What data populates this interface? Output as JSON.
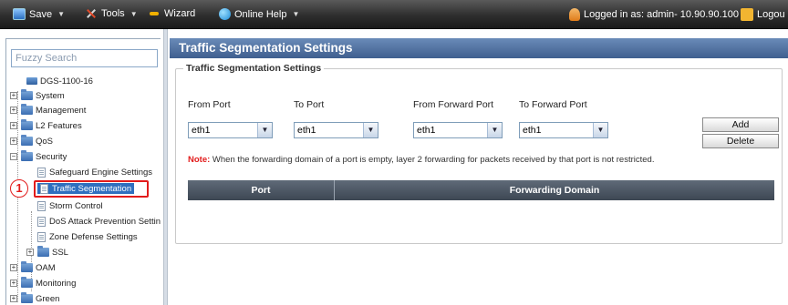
{
  "toolbar": {
    "save": "Save",
    "tools": "Tools",
    "wizard": "Wizard",
    "online_help": "Online Help",
    "logged_in": "Logged in as: admin- 10.90.90.100",
    "logout": "Logou"
  },
  "sidebar": {
    "search_placeholder": "Fuzzy Search",
    "device": "DGS-1100-16",
    "items": {
      "system": "System",
      "management": "Management",
      "l2_features": "L2 Features",
      "qos": "QoS",
      "security": "Security",
      "safeguard": "Safeguard Engine Settings",
      "traffic_segmentation": "Traffic Segmentation",
      "storm_control": "Storm Control",
      "dos": "DoS Attack Prevention Settin",
      "zone_defense": "Zone Defense Settings",
      "ssl": "SSL",
      "oam": "OAM",
      "monitoring": "Monitoring",
      "green": "Green"
    },
    "callout": "1"
  },
  "main": {
    "title": "Traffic Segmentation Settings",
    "section_legend": "Traffic Segmentation Settings",
    "labels": {
      "from_port": "From Port",
      "to_port": "To Port",
      "from_forward_port": "From Forward Port",
      "to_forward_port": "To Forward Port"
    },
    "selects": {
      "from_port": "eth1",
      "to_port": "eth1",
      "from_forward_port": "eth1",
      "to_forward_port": "eth1"
    },
    "buttons": {
      "add": "Add",
      "delete": "Delete"
    },
    "note_label": "Note:",
    "note_text": " When the forwarding domain of a port is empty, layer 2 forwarding for packets received by that port is not restricted.",
    "table_headers": {
      "port": "Port",
      "forwarding_domain": "Forwarding Domain"
    }
  },
  "colors": {
    "accent": "#3f5f8f",
    "highlight": "#e21b1b",
    "selected": "#2f6fbf"
  }
}
